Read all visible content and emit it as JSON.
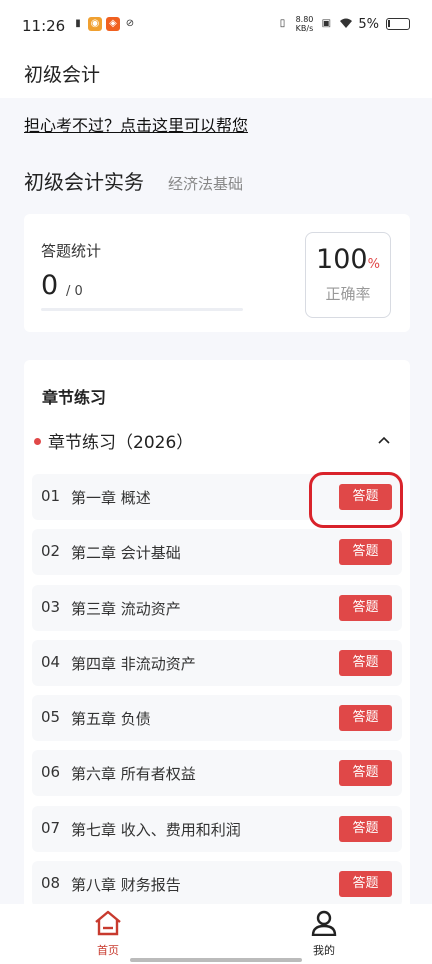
{
  "status_bar": {
    "time": "11:26",
    "net_speed": "8.80",
    "net_unit": "KB/s",
    "battery": "5%"
  },
  "header": {
    "title": "初级会计"
  },
  "help_link": "担心考不过？点击这里可以帮您",
  "subjects": {
    "active": "初级会计实务",
    "inactive": "经济法基础"
  },
  "stats": {
    "label": "答题统计",
    "answered": "0",
    "total": "/ 0",
    "progress": 0,
    "rate_value": "100",
    "rate_unit": "%",
    "rate_label": "正确率"
  },
  "practice": {
    "title": "章节练习",
    "group_title": "章节练习（2026）",
    "button_label": "答题",
    "chapters": [
      {
        "num": "01",
        "name": "第一章 概述"
      },
      {
        "num": "02",
        "name": "第二章 会计基础"
      },
      {
        "num": "03",
        "name": "第三章 流动资产"
      },
      {
        "num": "04",
        "name": "第四章 非流动资产"
      },
      {
        "num": "05",
        "name": "第五章 负债"
      },
      {
        "num": "06",
        "name": "第六章 所有者权益"
      },
      {
        "num": "07",
        "name": "第七章 收入、费用和利润"
      },
      {
        "num": "08",
        "name": "第八章 财务报告"
      }
    ]
  },
  "nav": {
    "home": "首页",
    "mine": "我的"
  },
  "colors": {
    "accent": "#e04848",
    "nav_active": "#c83a2e",
    "annotation": "#d9232b"
  }
}
